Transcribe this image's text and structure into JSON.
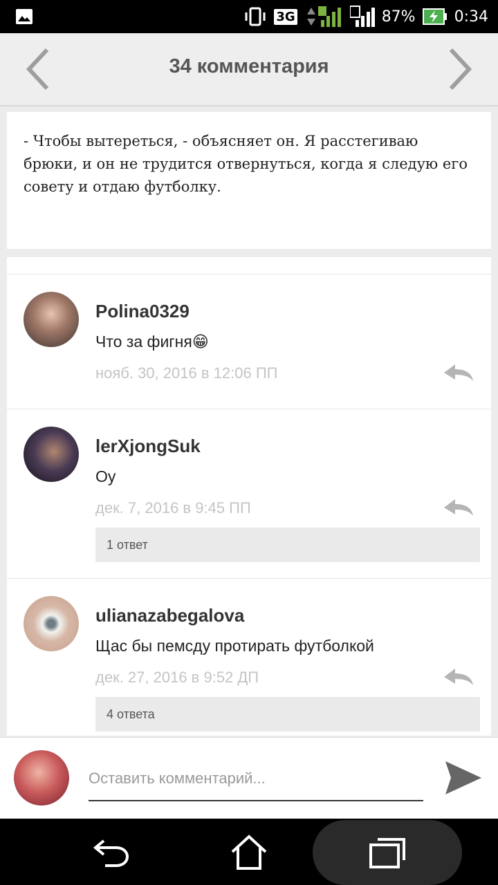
{
  "status_bar": {
    "network": "3G",
    "sim_badge_1": "1",
    "sim_badge_2": "2",
    "battery": "87%",
    "time": "0:34"
  },
  "header": {
    "title": "34 комментария"
  },
  "quote": {
    "text": "- Чтобы вытереться, - объясняет он. Я расстегиваю брюки, и он не трудится отвернуться, когда я следую его совету и отдаю футболку."
  },
  "comments": [
    {
      "author": "Polina0329",
      "text": "Что за фигня😁",
      "date": "нояб. 30, 2016 в 12:06 ПП",
      "replies": ""
    },
    {
      "author": "lerXjongSuk",
      "text": "Оу",
      "date": "дек. 7, 2016 в 9:45 ПП",
      "replies": "1 ответ"
    },
    {
      "author": "ulianazabegalova",
      "text": "Щас бы пемсду протирать футболкой",
      "date": "дек. 27, 2016 в 9:52 ДП",
      "replies": "4 ответа"
    }
  ],
  "composer": {
    "placeholder": "Оставить комментарий..."
  },
  "colors": {
    "header_bg": "#eeeeee",
    "date_gray": "#c4c4c4",
    "reply_box": "#eaeaea"
  },
  "icons": [
    "image-icon",
    "vibrate-icon",
    "signal-icon",
    "battery-icon",
    "chevron-left-icon",
    "chevron-right-icon",
    "reply-icon",
    "send-icon",
    "back-icon",
    "home-icon",
    "recents-icon"
  ]
}
